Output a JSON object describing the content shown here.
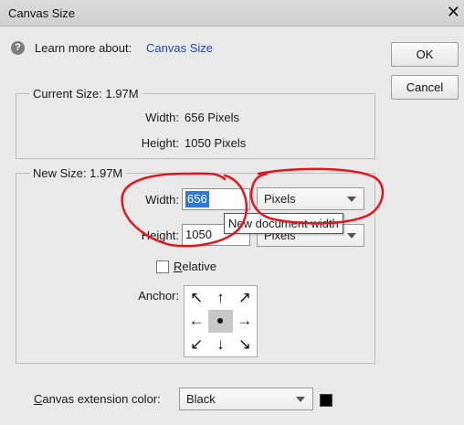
{
  "window": {
    "title": "Canvas Size",
    "close_glyph": "✕"
  },
  "help": {
    "icon_glyph": "?",
    "label": "Learn more about:",
    "link": "Canvas Size"
  },
  "buttons": {
    "ok": "OK",
    "cancel": "Cancel"
  },
  "current_size": {
    "legend": "Current Size: 1.97M",
    "width_label": "Width:",
    "width_value": "656 Pixels",
    "height_label": "Height:",
    "height_value": "1050 Pixels"
  },
  "new_size": {
    "legend": "New Size: 1.97M",
    "width_label": "Width:",
    "width_value": "656",
    "width_unit": "Pixels",
    "height_label": "Height:",
    "height_value": "1050",
    "height_unit": "Pixels",
    "tooltip": "New document width",
    "relative_label": "Relative",
    "relative_checked": false,
    "anchor_label": "Anchor:"
  },
  "anchor": {
    "arrows": [
      "↖",
      "↑",
      "↗",
      "←",
      "",
      "→",
      "↙",
      "↓",
      "↘"
    ],
    "icon_names": [
      "arrow-up-left-icon",
      "arrow-up-icon",
      "arrow-up-right-icon",
      "arrow-left-icon",
      "anchor-center-dot",
      "arrow-right-icon",
      "arrow-down-left-icon",
      "arrow-down-icon",
      "arrow-down-right-icon"
    ]
  },
  "extension": {
    "label": "Canvas extension color:",
    "value": "Black",
    "swatch_color": "#000000"
  },
  "annotation_color": "#e2161c"
}
